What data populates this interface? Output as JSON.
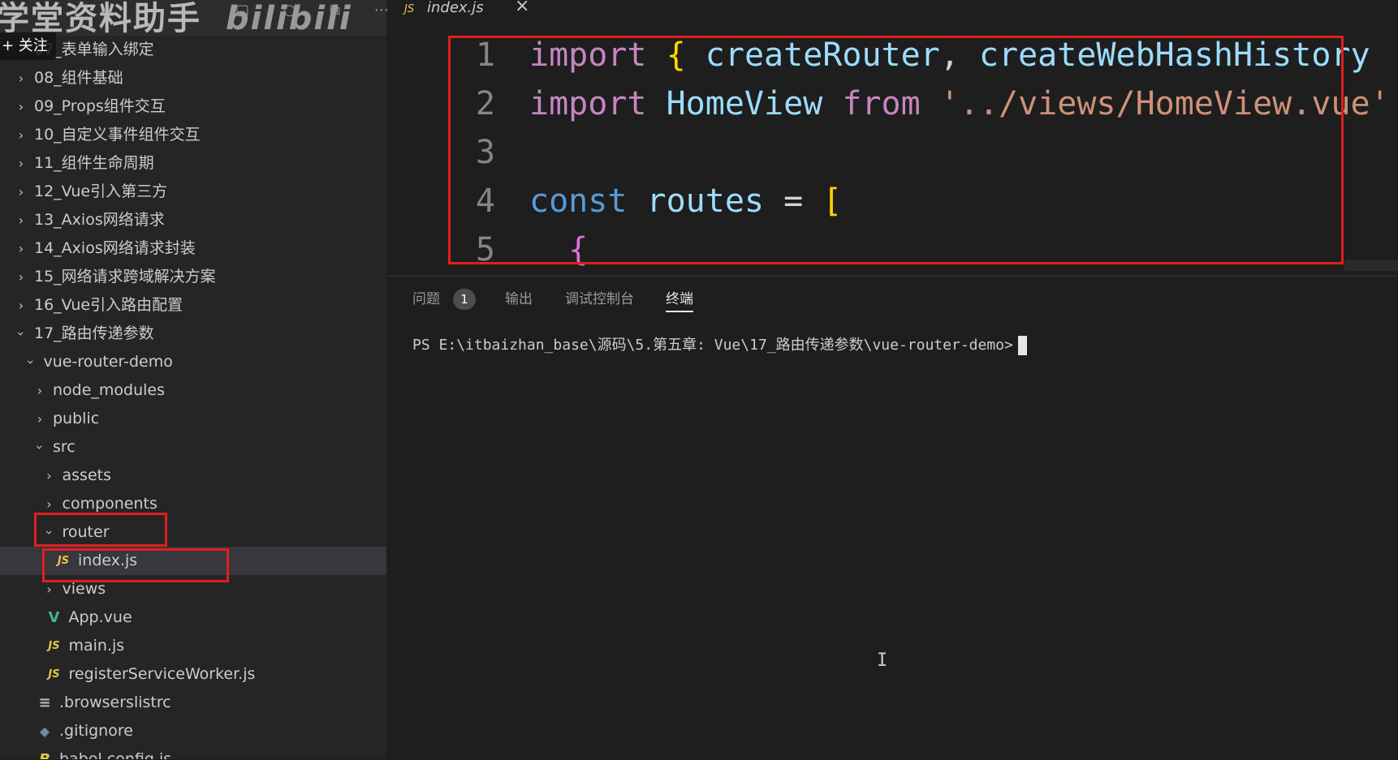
{
  "watermark": {
    "text": "学堂资料助手",
    "logo": "bilibili"
  },
  "follow_label": "+ 关注",
  "sidebar": {
    "items": [
      {
        "label": "07_表单输入绑定",
        "indent": 0,
        "type": "folder",
        "expanded": false
      },
      {
        "label": "08_组件基础",
        "indent": 0,
        "type": "folder",
        "expanded": false
      },
      {
        "label": "09_Props组件交互",
        "indent": 0,
        "type": "folder",
        "expanded": false
      },
      {
        "label": "10_自定义事件组件交互",
        "indent": 0,
        "type": "folder",
        "expanded": false
      },
      {
        "label": "11_组件生命周期",
        "indent": 0,
        "type": "folder",
        "expanded": false
      },
      {
        "label": "12_Vue引入第三方",
        "indent": 0,
        "type": "folder",
        "expanded": false
      },
      {
        "label": "13_Axios网络请求",
        "indent": 0,
        "type": "folder",
        "expanded": false
      },
      {
        "label": "14_Axios网络请求封装",
        "indent": 0,
        "type": "folder",
        "expanded": false
      },
      {
        "label": "15_网络请求跨域解决方案",
        "indent": 0,
        "type": "folder",
        "expanded": false
      },
      {
        "label": "16_Vue引入路由配置",
        "indent": 0,
        "type": "folder",
        "expanded": false
      },
      {
        "label": "17_路由传递参数",
        "indent": 0,
        "type": "folder",
        "expanded": true
      },
      {
        "label": "vue-router-demo",
        "indent": 1,
        "type": "folder",
        "expanded": true
      },
      {
        "label": "node_modules",
        "indent": 2,
        "type": "folder",
        "expanded": false
      },
      {
        "label": "public",
        "indent": 2,
        "type": "folder",
        "expanded": false
      },
      {
        "label": "src",
        "indent": 2,
        "type": "folder",
        "expanded": true
      },
      {
        "label": "assets",
        "indent": 3,
        "type": "folder",
        "expanded": false
      },
      {
        "label": "components",
        "indent": 3,
        "type": "folder",
        "expanded": false
      },
      {
        "label": "router",
        "indent": 3,
        "type": "folder",
        "expanded": true
      },
      {
        "label": "index.js",
        "indent": 4,
        "type": "js",
        "selected": true
      },
      {
        "label": "views",
        "indent": 3,
        "type": "folder",
        "expanded": false
      },
      {
        "label": "App.vue",
        "indent": 3,
        "type": "vue"
      },
      {
        "label": "main.js",
        "indent": 3,
        "type": "js"
      },
      {
        "label": "registerServiceWorker.js",
        "indent": 3,
        "type": "js"
      },
      {
        "label": ".browserslistrc",
        "indent": 2,
        "type": "list"
      },
      {
        "label": ".gitignore",
        "indent": 2,
        "type": "git"
      },
      {
        "label": "babel.config.js",
        "indent": 2,
        "type": "babel"
      }
    ]
  },
  "editor": {
    "tab": {
      "icon": "JS",
      "label": "index.js"
    },
    "lines": [
      {
        "n": "1",
        "tokens": [
          [
            "k-import",
            "import"
          ],
          [
            "punc",
            " "
          ],
          [
            "brace-y",
            "{"
          ],
          [
            "punc",
            " "
          ],
          [
            "id",
            "createRouter"
          ],
          [
            "punc",
            ", "
          ],
          [
            "id",
            "createWebHashHistory"
          ]
        ]
      },
      {
        "n": "2",
        "tokens": [
          [
            "k-import",
            "import"
          ],
          [
            "punc",
            " "
          ],
          [
            "id",
            "HomeView"
          ],
          [
            "punc",
            " "
          ],
          [
            "k-import",
            "from"
          ],
          [
            "punc",
            " "
          ],
          [
            "str",
            "'../views/HomeView.vue'"
          ]
        ]
      },
      {
        "n": "3",
        "tokens": []
      },
      {
        "n": "4",
        "tokens": [
          [
            "k-blue",
            "const"
          ],
          [
            "punc",
            " "
          ],
          [
            "id",
            "routes"
          ],
          [
            "punc",
            " = "
          ],
          [
            "brace-y",
            "["
          ]
        ]
      },
      {
        "n": "5",
        "tokens": [
          [
            "punc",
            "  "
          ],
          [
            "brace-p",
            "{"
          ]
        ]
      }
    ]
  },
  "panel": {
    "tabs": [
      "问题",
      "输出",
      "调试控制台",
      "终端"
    ],
    "problems_badge": "1",
    "active_tab": "终端",
    "terminal_prompt": "PS E:\\itbaizhan_base\\源码\\5.第五章: Vue\\17_路由传递参数\\vue-router-demo>"
  },
  "colors": {
    "highlight_box": "#e01e1e",
    "accent": "#007acc"
  }
}
